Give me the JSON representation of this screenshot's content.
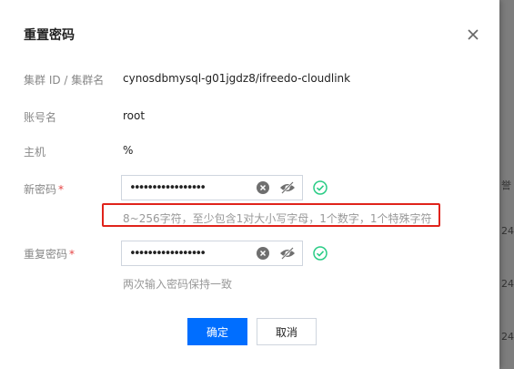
{
  "dialog": {
    "title": "重置密码",
    "close_icon": "close-icon"
  },
  "fields": {
    "cluster": {
      "label": "集群 ID / 集群名",
      "value": "cynosdbmysql-g01jgdz8/ifreedo-cloudlink"
    },
    "account": {
      "label": "账号名",
      "value": "root"
    },
    "host": {
      "label": "主机",
      "value": "%"
    },
    "new_password": {
      "label": "新密码",
      "required_mark": "*",
      "value": "•••••••••••••••••",
      "hint": "8~256字符，至少包含1对大小写字母，1个数字，1个特殊字符"
    },
    "confirm_password": {
      "label": "重复密码",
      "required_mark": "*",
      "value": "•••••••••••••••••",
      "hint": "两次输入密码保持一致"
    }
  },
  "footer": {
    "confirm_label": "确定",
    "cancel_label": "取消"
  },
  "backdrop": {
    "peek_texts": [
      "誉",
      "24",
      "24",
      "24"
    ]
  },
  "colors": {
    "primary": "#006eff",
    "success": "#29cc85",
    "error": "#e54545",
    "highlight_box": "#e0231b"
  }
}
